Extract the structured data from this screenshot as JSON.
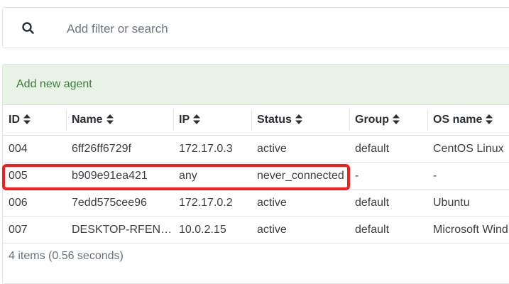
{
  "search": {
    "placeholder": "Add filter or search",
    "icon": "search-icon"
  },
  "callout": {
    "text": "Add new agent"
  },
  "table": {
    "columns": [
      "ID",
      "Name",
      "IP",
      "Status",
      "Group",
      "OS name"
    ],
    "rows": [
      [
        "004",
        "6ff26ff6729f",
        "172.17.0.3",
        "active",
        "default",
        "CentOS Linux"
      ],
      [
        "005",
        "b909e91ea421",
        "any",
        "never_connected",
        "-",
        "-"
      ],
      [
        "006",
        "7edd575cee96",
        "172.17.0.2",
        "active",
        "default",
        "Ubuntu"
      ],
      [
        "007",
        "DESKTOP-RFENHB",
        "10.0.2.15",
        "active",
        "default",
        "Microsoft Windows"
      ]
    ],
    "highlighted_row_id": "005"
  },
  "footer": {
    "summary": "4 items (0.56 seconds)"
  },
  "colors": {
    "callout_bg": "#e7f4e5",
    "callout_text": "#3f7a3a",
    "highlight": "#ff1a1a"
  }
}
